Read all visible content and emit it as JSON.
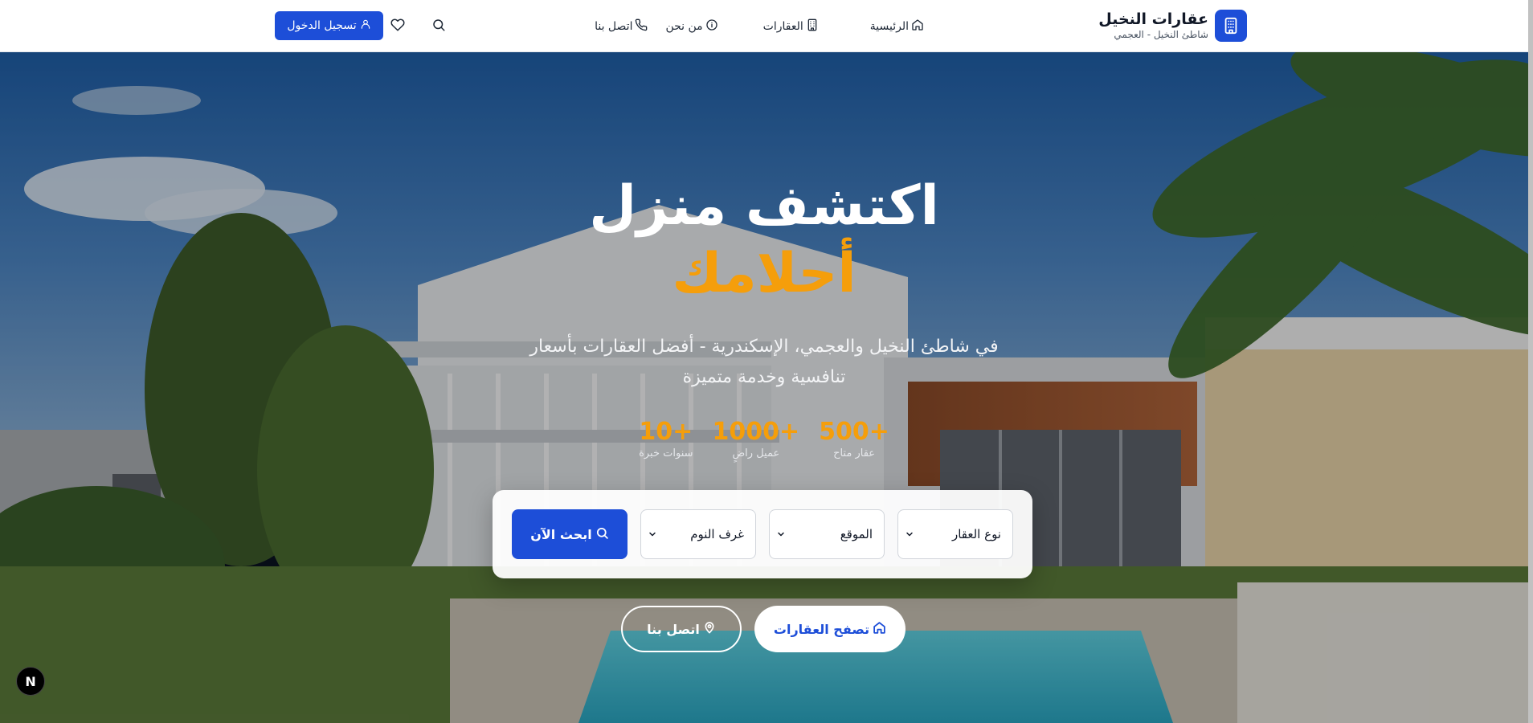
{
  "header": {
    "brand_name": "عقارات النخيل",
    "brand_subtitle": "شاطئ النخيل - العجمي",
    "brand_icon": "building-icon",
    "nav": [
      {
        "label": "الرئيسية",
        "icon": "home-icon"
      },
      {
        "label": "العقارات",
        "icon": "building-icon"
      },
      {
        "label": "من نحن",
        "icon": "info-icon"
      },
      {
        "label": "اتصل بنا",
        "icon": "phone-icon"
      }
    ],
    "login_label": "تسجيل الدخول",
    "login_icon": "user-icon",
    "search_icon": "search-icon",
    "favorites_icon": "heart-icon"
  },
  "hero": {
    "title_line1": "اكتشف منزل",
    "title_line2": "أحلامك",
    "subtitle": "في شاطئ النخيل والعجمي، الإسكندرية - أفضل العقارات بأسعار تنافسية وخدمة متميزة",
    "stats": [
      {
        "value": "+500",
        "label": "عقار متاح"
      },
      {
        "value": "+1000",
        "label": "عميل راضٍ"
      },
      {
        "value": "+10",
        "label": "سنوات خبرة"
      }
    ],
    "search": {
      "property_type": "نوع العقار",
      "location": "الموقع",
      "bedrooms": "غرف النوم",
      "search_button": "ابحث الآن"
    },
    "cta_browse": "تصفح العقارات",
    "cta_contact": "اتصل بنا"
  },
  "badge": "N",
  "colors": {
    "primary": "#1d4ed8",
    "accent": "#f59e0b",
    "header_bg": "#ffffff"
  }
}
